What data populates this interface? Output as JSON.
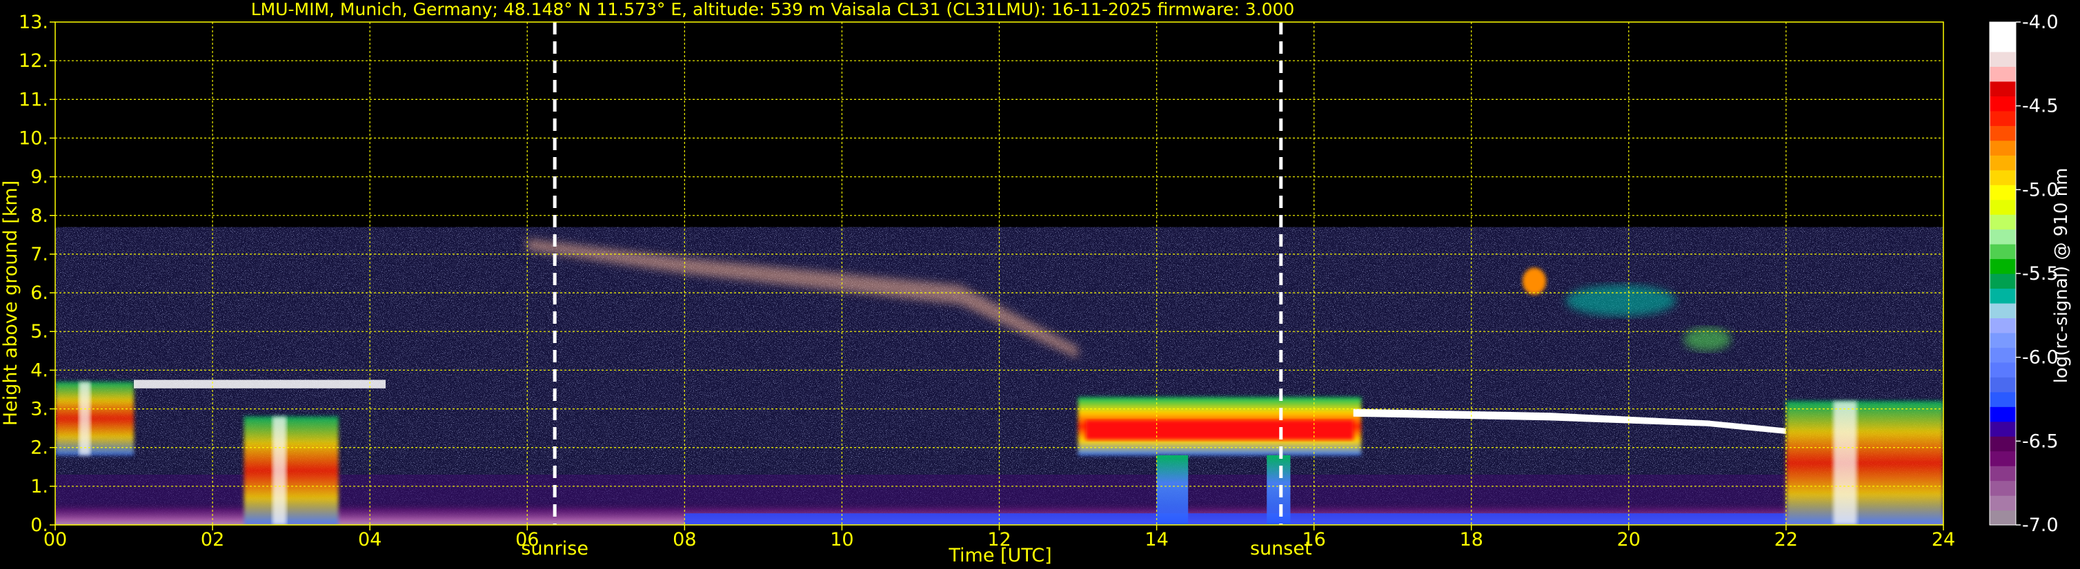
{
  "title": "LMU-MIM, Munich, Germany; 48.148° N 11.573° E, altitude: 539 m    Vaisala CL31 (CL31LMU): 16-11-2025    firmware: 3.000",
  "colors": {
    "text": "#ffff00",
    "grid": "#ffff00",
    "background": "#000000",
    "markers": "#ffffff"
  },
  "chart_data": {
    "type": "heatmap",
    "title": "LMU-MIM, Munich, Germany; 48.148° N 11.573° E, altitude: 539 m    Vaisala CL31 (CL31LMU): 16-11-2025    firmware: 3.000",
    "xlabel": "Time [UTC]",
    "ylabel": "Height above ground [km]",
    "xlim": [
      0,
      24
    ],
    "ylim": [
      0,
      13
    ],
    "x_ticks": [
      "00",
      "02",
      "04",
      "06",
      "08",
      "10",
      "12",
      "14",
      "16",
      "18",
      "20",
      "22",
      "24"
    ],
    "y_ticks": [
      "0.",
      "1.",
      "2.",
      "3.",
      "4.",
      "5.",
      "6.",
      "7.",
      "8.",
      "9.",
      "10.",
      "11.",
      "12.",
      "13."
    ],
    "grid": true,
    "data_top_km": 7.7,
    "events": [
      {
        "label": "sunrise",
        "time": 6.35
      },
      {
        "label": "sunset",
        "time": 15.58
      }
    ],
    "colorbar": {
      "label": "log(rc-signal) @ 910 nm",
      "range": [
        -7.0,
        -4.0
      ],
      "ticks": [
        "-4.0",
        "-4.5",
        "-5.0",
        "-5.5",
        "-6.0",
        "-6.5",
        "-7.0"
      ],
      "colors": [
        "#9e8c9e",
        "#a87aa8",
        "#9a5a9a",
        "#8a3a8a",
        "#700a70",
        "#5a005a",
        "#3a00a0",
        "#0000ff",
        "#2a5aff",
        "#4a6af0",
        "#5a7aff",
        "#6a8aff",
        "#7a9aff",
        "#9aaaff",
        "#9ad2e6",
        "#00b4a0",
        "#00a050",
        "#00b400",
        "#50d050",
        "#a0f0a0",
        "#c0ff60",
        "#e6ff00",
        "#ffff00",
        "#ffd700",
        "#ffb000",
        "#ff8c00",
        "#ff5000",
        "#ff2000",
        "#ff0000",
        "#dc0000",
        "#ffb4b4",
        "#f0dcdc",
        "#ffffff",
        "#ffffff"
      ]
    },
    "features": [
      {
        "name": "low cloud / PBL layer",
        "x": [
          0.0,
          1.0
        ],
        "y": [
          1.8,
          3.7
        ]
      },
      {
        "name": "cloud layer",
        "x": [
          1.0,
          4.2
        ],
        "y": [
          3.4,
          3.9
        ]
      },
      {
        "name": "precipitation/cloud",
        "x": [
          2.4,
          3.6
        ],
        "y": [
          0.0,
          2.8
        ]
      },
      {
        "name": "cirrus",
        "x": [
          6.0,
          13.0
        ],
        "y": [
          4.5,
          7.5
        ]
      },
      {
        "name": "thick cloud layer",
        "x": [
          13.0,
          16.6
        ],
        "y": [
          1.8,
          3.3
        ]
      },
      {
        "name": "stratocumulus layer",
        "x": [
          16.5,
          22.0
        ],
        "y": [
          2.3,
          3.1
        ]
      },
      {
        "name": "elevated clouds",
        "x": [
          18.6,
          21.3
        ],
        "y": [
          4.5,
          6.6
        ]
      },
      {
        "name": "low clouds/precipitation",
        "x": [
          22.0,
          24.0
        ],
        "y": [
          0.0,
          3.2
        ]
      }
    ]
  }
}
